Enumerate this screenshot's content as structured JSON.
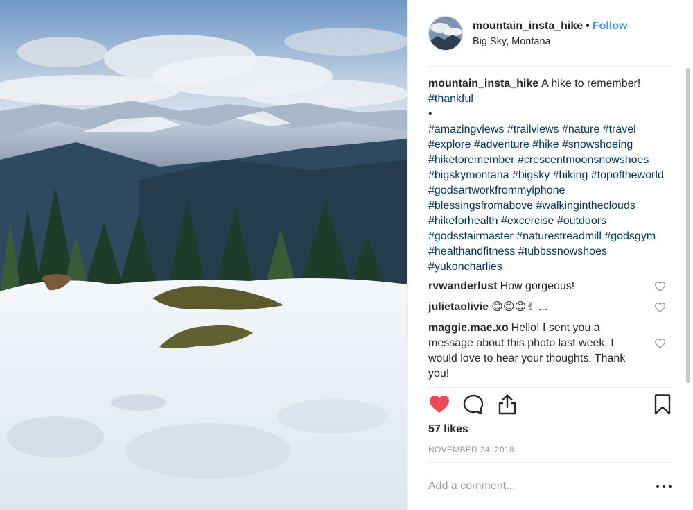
{
  "post": {
    "username": "mountain_insta_hike",
    "separator": "•",
    "follow_label": "Follow",
    "location": "Big Sky, Montana",
    "photo_description": "Snowy mountain summit with pine trees and valley view"
  },
  "caption": {
    "username": "mountain_insta_hike",
    "text": "A hike to remember!",
    "tag_line1": "#thankful",
    "bullet": "•",
    "hashtags": "#amazingviews #trailviews #nature #travel #explore #adventure #hike #snowshoeing #hiketoremember #crescentmoonsnowshoes #bigskymontana #bigsky #hiking #topoftheworld #godsartworkfrommyiphone #blessingsfromabove #walkingintheclouds #hikeforhealth #excercise #outdoors #godsstairmaster #naturestreadmill #godsgym #healthandfitness #tubbssnowshoes #yukoncharlies"
  },
  "comments": [
    {
      "username": "rvwanderlust",
      "text": "How gorgeous!"
    },
    {
      "username": "julietaolivie",
      "text": "😊😊😊✌ ..."
    },
    {
      "username": "maggie.mae.xo",
      "text": "Hello! I sent you a message about this photo last week. I would love to hear your thoughts. Thank you!"
    }
  ],
  "stats": {
    "likes": "57 likes",
    "date": "NOVEMBER 24, 2018"
  },
  "comment_box": {
    "placeholder": "Add a comment..."
  },
  "icons": {
    "like": "heart-filled-icon",
    "comment": "comment-bubble-icon",
    "share": "share-icon",
    "save": "bookmark-icon",
    "more": "more-options-icon"
  },
  "colors": {
    "like_red": "#ed4956",
    "follow_blue": "#3897f0",
    "hashtag_blue": "#003569",
    "muted_gray": "#999999"
  }
}
